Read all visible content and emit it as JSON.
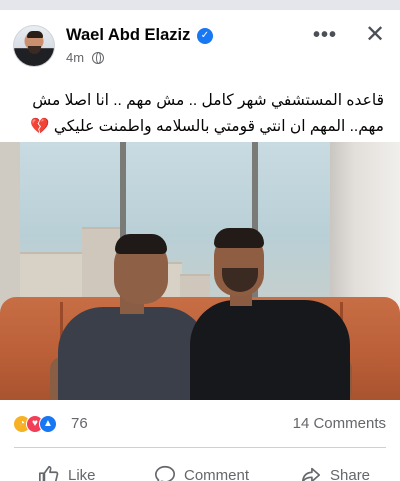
{
  "post": {
    "author": "Wael Abd Elaziz",
    "time": "4m",
    "text_line1": "قاعده المستشفي شهر كامل .. مش مهم .. انا اصلا مش",
    "text_line2": "مهم.. المهم ان انتي قومتي بالسلامه واطمنت عليكي 💔",
    "reaction_count": "76",
    "comments_label": "14 Comments"
  },
  "actions": {
    "like": "Like",
    "comment": "Comment",
    "share": "Share"
  },
  "header": {
    "more_glyph": "•••",
    "close_glyph": "✕",
    "verified_glyph": "✓"
  },
  "icons": {
    "avatar": "avatar",
    "verified": "verified-badge-icon",
    "privacy": "globe-icon",
    "reactions": [
      "care-reaction-icon",
      "love-reaction-icon",
      "like-reaction-icon"
    ]
  },
  "colors": {
    "accent": "#1877f2",
    "love": "#f33e58",
    "care": "#f7b125",
    "secondary_text": "#65676b"
  }
}
